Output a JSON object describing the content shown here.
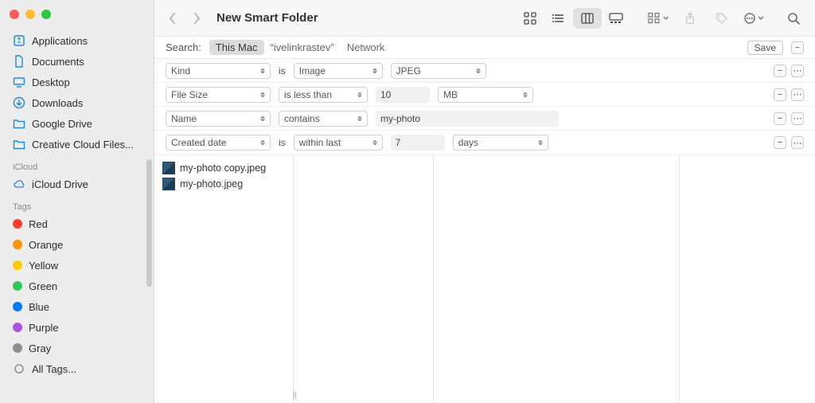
{
  "window": {
    "title": "New Smart Folder"
  },
  "sidebar": {
    "favorites": [
      {
        "label": "Applications",
        "icon": "applications"
      },
      {
        "label": "Documents",
        "icon": "document"
      },
      {
        "label": "Desktop",
        "icon": "desktop"
      },
      {
        "label": "Downloads",
        "icon": "downloads"
      },
      {
        "label": "Google Drive",
        "icon": "folder"
      },
      {
        "label": "Creative Cloud Files...",
        "icon": "folder"
      }
    ],
    "icloud_section": "iCloud",
    "icloud": [
      {
        "label": "iCloud Drive",
        "icon": "cloud"
      }
    ],
    "tags_section": "Tags",
    "tags": [
      {
        "label": "Red",
        "color": "#ff3b30"
      },
      {
        "label": "Orange",
        "color": "#ff9500"
      },
      {
        "label": "Yellow",
        "color": "#ffcc00"
      },
      {
        "label": "Green",
        "color": "#34c759"
      },
      {
        "label": "Blue",
        "color": "#007aff"
      },
      {
        "label": "Purple",
        "color": "#af52de"
      },
      {
        "label": "Gray",
        "color": "#8e8e93"
      }
    ],
    "all_tags": "All Tags..."
  },
  "scope": {
    "label": "Search:",
    "options": [
      "This Mac",
      "“ivelinkrastev”",
      "Network"
    ],
    "active": 0,
    "save": "Save"
  },
  "criteria": [
    {
      "attr": "Kind",
      "joiner": "is",
      "op": "Image",
      "value": "",
      "unit": "JPEG",
      "value_type": "none"
    },
    {
      "attr": "File Size",
      "joiner": "",
      "op": "is less than",
      "value": "10",
      "unit": "MB",
      "value_type": "num"
    },
    {
      "attr": "Name",
      "joiner": "",
      "op": "contains",
      "value": "my-photo",
      "unit": "",
      "value_type": "text"
    },
    {
      "attr": "Created date",
      "joiner": "is",
      "op": "within last",
      "value": "7",
      "unit": "days",
      "value_type": "num"
    }
  ],
  "results": [
    "my-photo copy.jpeg",
    "my-photo.jpeg"
  ]
}
